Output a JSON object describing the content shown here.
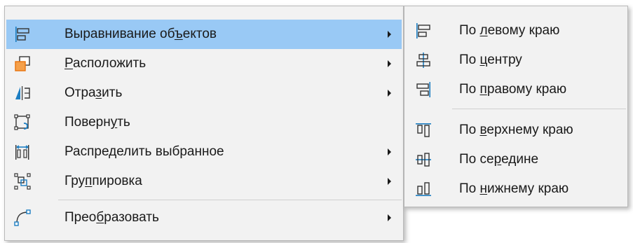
{
  "colors": {
    "highlight": "#99c9f5",
    "icon_blue": "#1d7ec2",
    "icon_orange": "#e8720c",
    "icon_dark": "#333333"
  },
  "menu": {
    "items": [
      {
        "pre": "Выравнивание об",
        "acc": "ъ",
        "post": "ектов",
        "icon": "align-left-icon",
        "submenu": true
      },
      {
        "pre": "",
        "acc": "Р",
        "post": "асположить",
        "icon": "arrange-icon",
        "submenu": true
      },
      {
        "pre": "Отра",
        "acc": "з",
        "post": "ить",
        "icon": "flip-icon",
        "submenu": true
      },
      {
        "pre": "Поверн",
        "acc": "у",
        "post": "ть",
        "icon": "rotate-icon",
        "submenu": false
      },
      {
        "pre": "Распре",
        "acc": "д",
        "post": "елить выбранное",
        "icon": "distribute-icon",
        "submenu": true
      },
      {
        "pre": "Гру",
        "acc": "п",
        "post": "пировка",
        "icon": "group-icon",
        "submenu": true
      },
      {
        "pre": "Прео",
        "acc": "б",
        "post": "разовать",
        "icon": "convert-icon",
        "submenu": true
      }
    ]
  },
  "submenu": {
    "items": [
      {
        "pre": "По ",
        "acc": "л",
        "post": "евому краю",
        "icon": "align-left-icon"
      },
      {
        "pre": "По ",
        "acc": "ц",
        "post": "ентру",
        "icon": "align-center-icon"
      },
      {
        "pre": "По ",
        "acc": "п",
        "post": "равому краю",
        "icon": "align-right-icon"
      },
      {
        "pre": "По ",
        "acc": "в",
        "post": "ерхнему краю",
        "icon": "align-top-icon"
      },
      {
        "pre": "По се",
        "acc": "р",
        "post": "едине",
        "icon": "align-middle-icon"
      },
      {
        "pre": "По ",
        "acc": "н",
        "post": "ижнему краю",
        "icon": "align-bottom-icon"
      }
    ]
  }
}
